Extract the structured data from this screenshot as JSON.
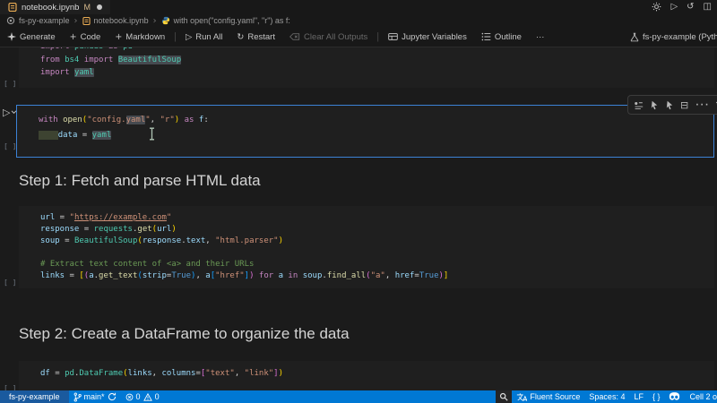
{
  "tab": {
    "title": "notebook.ipynb",
    "git_status": "M"
  },
  "breadcrumb": {
    "project": "fs-py-example",
    "file": "notebook.ipynb",
    "symbol": "with open(\"config.yaml\", \"r\") as f:"
  },
  "toolbar": {
    "generate": "Generate",
    "code": "Code",
    "markdown": "Markdown",
    "run_all": "Run All",
    "restart": "Restart",
    "clear_outputs": "Clear All Outputs",
    "variables": "Jupyter Variables",
    "outline": "Outline",
    "more": "···",
    "kernel": "fs-py-example (Python"
  },
  "headings": {
    "step1": "Step 1: Fetch and parse HTML data",
    "step2": "Step 2: Create a DataFrame to organize the data"
  },
  "cells": {
    "c1": {
      "exec": "[ ]",
      "lines": [
        [
          [
            "import ",
            "kw"
          ],
          [
            "pandas",
            "cls"
          ],
          [
            " as ",
            "kw"
          ],
          [
            "pd",
            "cls"
          ]
        ],
        [
          [
            "from ",
            "kw"
          ],
          [
            "bs4",
            "cls"
          ],
          [
            " import ",
            "kw"
          ],
          [
            "BeautifulSoup",
            "cls hl"
          ]
        ],
        [
          [
            "import ",
            "kw"
          ],
          [
            "yaml",
            "cls hl"
          ]
        ]
      ]
    },
    "c2": {
      "exec": "[ ]",
      "lines": [
        [
          [
            "with ",
            "kw"
          ],
          [
            "open",
            "fn"
          ],
          [
            "(",
            "b1"
          ],
          [
            "\"config.",
            "str"
          ],
          [
            "yaml",
            "str hl"
          ],
          [
            "\"",
            "str"
          ],
          [
            ", ",
            "op"
          ],
          [
            "\"r\"",
            "str"
          ],
          [
            ")",
            "b1"
          ],
          [
            " as ",
            "kw"
          ],
          [
            "f",
            "var"
          ],
          [
            ":",
            "op"
          ]
        ],
        [
          [
            "    ",
            "selbox"
          ],
          [
            "data",
            "var"
          ],
          [
            " = ",
            "op"
          ],
          [
            "yaml",
            "cls hl"
          ]
        ]
      ]
    },
    "c3": {
      "exec": "[ ]",
      "lines": [
        [
          [
            "url",
            "var"
          ],
          [
            " = ",
            "op"
          ],
          [
            "\"",
            "str"
          ],
          [
            "https://example.com",
            "lnk"
          ],
          [
            "\"",
            "str"
          ]
        ],
        [
          [
            "response",
            "var"
          ],
          [
            " = ",
            "op"
          ],
          [
            "requests",
            "cls"
          ],
          [
            ".",
            "op"
          ],
          [
            "get",
            "fn"
          ],
          [
            "(",
            "b1"
          ],
          [
            "url",
            "var"
          ],
          [
            ")",
            "b1"
          ]
        ],
        [
          [
            "soup",
            "var"
          ],
          [
            " = ",
            "op"
          ],
          [
            "BeautifulSoup",
            "cls"
          ],
          [
            "(",
            "b1"
          ],
          [
            "response",
            "var"
          ],
          [
            ".",
            "op"
          ],
          [
            "text",
            "var"
          ],
          [
            ", ",
            "op"
          ],
          [
            "\"html.parser\"",
            "str"
          ],
          [
            ")",
            "b1"
          ]
        ],
        [],
        [
          [
            "# Extract text content of <a> and their URLs",
            "com"
          ]
        ],
        [
          [
            "links",
            "var"
          ],
          [
            " = ",
            "op"
          ],
          [
            "[",
            "b1"
          ],
          [
            "(",
            "b2"
          ],
          [
            "a",
            "var"
          ],
          [
            ".",
            "op"
          ],
          [
            "get_text",
            "fn"
          ],
          [
            "(",
            "b3"
          ],
          [
            "strip",
            "var"
          ],
          [
            "=",
            "op"
          ],
          [
            "True",
            "const"
          ],
          [
            ")",
            "b3"
          ],
          [
            ", ",
            "op"
          ],
          [
            "a",
            "var"
          ],
          [
            "[",
            "b3"
          ],
          [
            "\"href\"",
            "str"
          ],
          [
            "]",
            "b3"
          ],
          [
            ")",
            "b2"
          ],
          [
            " for ",
            "kw"
          ],
          [
            "a",
            "var"
          ],
          [
            " in ",
            "kw"
          ],
          [
            "soup",
            "var"
          ],
          [
            ".",
            "op"
          ],
          [
            "find_all",
            "fn"
          ],
          [
            "(",
            "b2"
          ],
          [
            "\"a\"",
            "str"
          ],
          [
            ", ",
            "op"
          ],
          [
            "href",
            "var"
          ],
          [
            "=",
            "op"
          ],
          [
            "True",
            "const"
          ],
          [
            ")",
            "b2"
          ],
          [
            "]",
            "b1"
          ]
        ]
      ]
    },
    "c4": {
      "exec": "[ ]",
      "lines": [
        [
          [
            "df",
            "var"
          ],
          [
            " = ",
            "op"
          ],
          [
            "pd",
            "cls"
          ],
          [
            ".",
            "op"
          ],
          [
            "DataFrame",
            "cls"
          ],
          [
            "(",
            "b1"
          ],
          [
            "links",
            "var"
          ],
          [
            ", ",
            "op"
          ],
          [
            "columns",
            "var"
          ],
          [
            "=",
            "op"
          ],
          [
            "[",
            "b2"
          ],
          [
            "\"text\"",
            "str"
          ],
          [
            ", ",
            "op"
          ],
          [
            "\"link\"",
            "str"
          ],
          [
            "]",
            "b2"
          ],
          [
            ")",
            "b1"
          ]
        ]
      ]
    }
  },
  "statusbar": {
    "remote": "fs-py-example",
    "branch": "main*",
    "errors": "0",
    "warnings": "0",
    "fluent": "Fluent Source",
    "spaces": "Spaces: 4",
    "eol": "LF",
    "brackets": "{ }",
    "cell_indicator": "Cell 2 o"
  },
  "colors": {
    "statusbar_bg": "#0078d4",
    "remote_bg": "#1a5a9e",
    "focus_border": "#3c82d6",
    "cell_bg": "#1f1f1f",
    "editor_bg": "#1b1b1b",
    "modified_badge": "#d7ba8d"
  }
}
